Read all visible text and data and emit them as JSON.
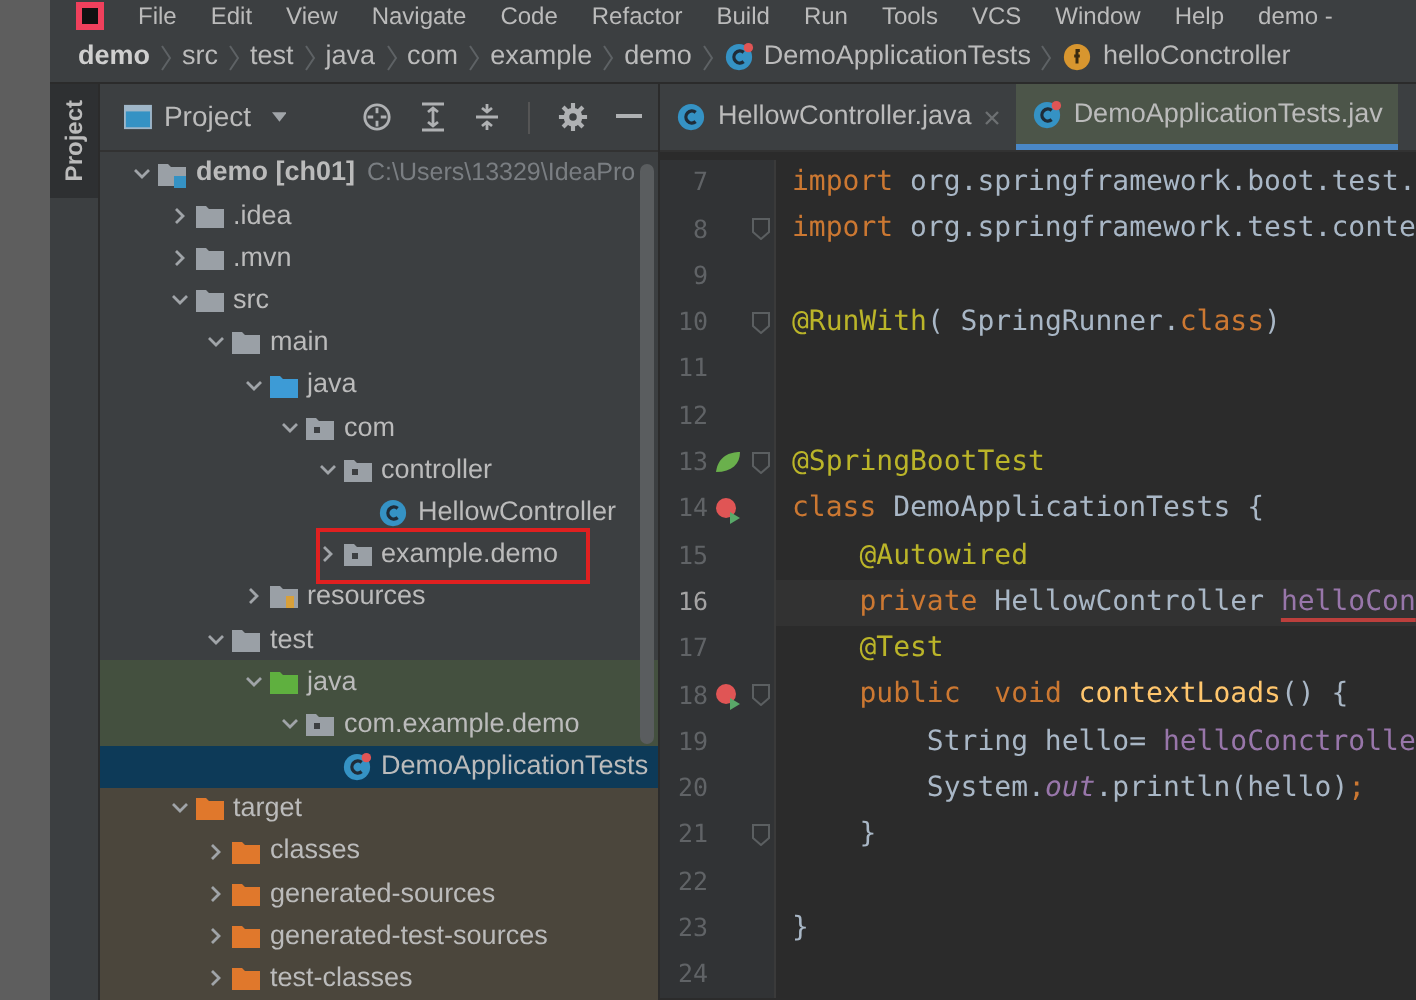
{
  "menu": [
    "File",
    "Edit",
    "View",
    "Navigate",
    "Code",
    "Refactor",
    "Build",
    "Run",
    "Tools",
    "VCS",
    "Window",
    "Help",
    "demo -"
  ],
  "breadcrumb": [
    {
      "label": "demo",
      "kind": "project"
    },
    {
      "label": "src",
      "kind": "dir"
    },
    {
      "label": "test",
      "kind": "dir"
    },
    {
      "label": "java",
      "kind": "dir"
    },
    {
      "label": "com",
      "kind": "dir"
    },
    {
      "label": "example",
      "kind": "dir"
    },
    {
      "label": "demo",
      "kind": "dir"
    },
    {
      "label": "DemoApplicationTests",
      "kind": "class"
    },
    {
      "label": "helloConctroller",
      "kind": "field"
    }
  ],
  "side_tab": {
    "label": "Project",
    "selected": true
  },
  "project_panel": {
    "title": "Project",
    "tree": [
      {
        "label": "demo [ch01]",
        "path": "C:\\Users\\13329\\IdeaPro",
        "kind": "module",
        "expanded": true,
        "selected": false,
        "children": [
          {
            "label": ".idea",
            "kind": "folder",
            "expanded": false,
            "selected": false
          },
          {
            "label": ".mvn",
            "kind": "folder",
            "expanded": false,
            "selected": false
          },
          {
            "label": "src",
            "kind": "folder",
            "expanded": true,
            "selected": false,
            "children": [
              {
                "label": "main",
                "kind": "folder",
                "expanded": true,
                "selected": false,
                "children": [
                  {
                    "label": "java",
                    "kind": "source",
                    "expanded": true,
                    "selected": false,
                    "children": [
                      {
                        "label": "com",
                        "kind": "package",
                        "expanded": true,
                        "selected": false,
                        "children": [
                          {
                            "label": "controller",
                            "kind": "package",
                            "expanded": true,
                            "selected": false,
                            "children": [
                              {
                                "label": "HellowController",
                                "kind": "class",
                                "selected": false
                              }
                            ]
                          },
                          {
                            "label": "example.demo",
                            "kind": "package",
                            "expanded": false,
                            "selected": false,
                            "annotated": true
                          }
                        ]
                      }
                    ]
                  },
                  {
                    "label": "resources",
                    "kind": "resources",
                    "expanded": false,
                    "selected": false
                  }
                ]
              },
              {
                "label": "test",
                "kind": "folder",
                "expanded": true,
                "selected": false,
                "children": [
                  {
                    "label": "java",
                    "kind": "test_source",
                    "expanded": true,
                    "selected": false,
                    "children": [
                      {
                        "label": "com.example.demo",
                        "kind": "package",
                        "expanded": true,
                        "selected": false,
                        "children": [
                          {
                            "label": "DemoApplicationTests",
                            "kind": "test_class",
                            "selected": true
                          }
                        ]
                      }
                    ]
                  }
                ]
              }
            ]
          },
          {
            "label": "target",
            "kind": "excluded",
            "expanded": true,
            "selected": false,
            "children": [
              {
                "label": "classes",
                "kind": "excluded",
                "expanded": false,
                "selected": false
              },
              {
                "label": "generated-sources",
                "kind": "excluded",
                "expanded": false,
                "selected": false
              },
              {
                "label": "generated-test-sources",
                "kind": "excluded",
                "expanded": false,
                "selected": false
              },
              {
                "label": "test-classes",
                "kind": "excluded",
                "expanded": false,
                "selected": false
              }
            ]
          }
        ]
      }
    ]
  },
  "tabs": [
    {
      "label": "HellowController.java",
      "kind": "class",
      "selected": false
    },
    {
      "label": "DemoApplicationTests.jav",
      "kind": "test_class",
      "selected": true
    }
  ],
  "code": [
    {
      "number": "7",
      "tokens": [
        {
          "text": "import",
          "kind": "keyword"
        },
        {
          "text": " org.springframework.boot.test.",
          "kind": "plain"
        }
      ]
    },
    {
      "number": "8",
      "fold": true,
      "tokens": [
        {
          "text": "import",
          "kind": "keyword"
        },
        {
          "text": " org.springframework.test.conte",
          "kind": "plain"
        }
      ]
    },
    {
      "number": "9"
    },
    {
      "number": "10",
      "fold": true,
      "tokens": [
        {
          "text": "@RunWith",
          "kind": "annotation"
        },
        {
          "text": "( SpringRunner.",
          "kind": "plain"
        },
        {
          "text": "class",
          "kind": "keyword"
        },
        {
          "text": ")",
          "kind": "plain"
        }
      ]
    },
    {
      "number": "11"
    },
    {
      "number": "12"
    },
    {
      "number": "13",
      "spring_icon": true,
      "fold": true,
      "tokens": [
        {
          "text": "@SpringBootTest",
          "kind": "annotation"
        }
      ]
    },
    {
      "number": "14",
      "run_icon": true,
      "tokens": [
        {
          "text": "class",
          "kind": "keyword"
        },
        {
          "text": " DemoApplicationTests {",
          "kind": "plain"
        }
      ]
    },
    {
      "number": "15",
      "tokens": [
        {
          "text": "    @Autowired",
          "kind": "annotation"
        }
      ]
    },
    {
      "number": "16",
      "current": true,
      "tokens": [
        {
          "text": "    private",
          "kind": "keyword"
        },
        {
          "text": " HellowController ",
          "kind": "plain"
        },
        {
          "text": "helloCon",
          "kind": "error_field"
        }
      ]
    },
    {
      "number": "17",
      "tokens": [
        {
          "text": "    @Test",
          "kind": "annotation"
        }
      ]
    },
    {
      "number": "18",
      "run_icon": true,
      "fold": true,
      "tokens": [
        {
          "text": "    public",
          "kind": "keyword"
        },
        {
          "text": "  void",
          "kind": "keyword"
        },
        {
          "text": " contextLoads",
          "kind": "method"
        },
        {
          "text": "() {",
          "kind": "plain"
        }
      ]
    },
    {
      "number": "19",
      "tokens": [
        {
          "text": "        String hello= ",
          "kind": "plain"
        },
        {
          "text": "helloConctrolle",
          "kind": "field"
        }
      ]
    },
    {
      "number": "20",
      "tokens": [
        {
          "text": "        System.",
          "kind": "plain"
        },
        {
          "text": "out",
          "kind": "static_field"
        },
        {
          "text": ".println(hello)",
          "kind": "plain"
        },
        {
          "text": ";",
          "kind": "keyword"
        }
      ]
    },
    {
      "number": "21",
      "fold": true,
      "tokens": [
        {
          "text": "    }",
          "kind": "plain"
        }
      ]
    },
    {
      "number": "22"
    },
    {
      "number": "23",
      "tokens": [
        {
          "text": "}",
          "kind": "plain"
        }
      ]
    },
    {
      "number": "24"
    }
  ]
}
